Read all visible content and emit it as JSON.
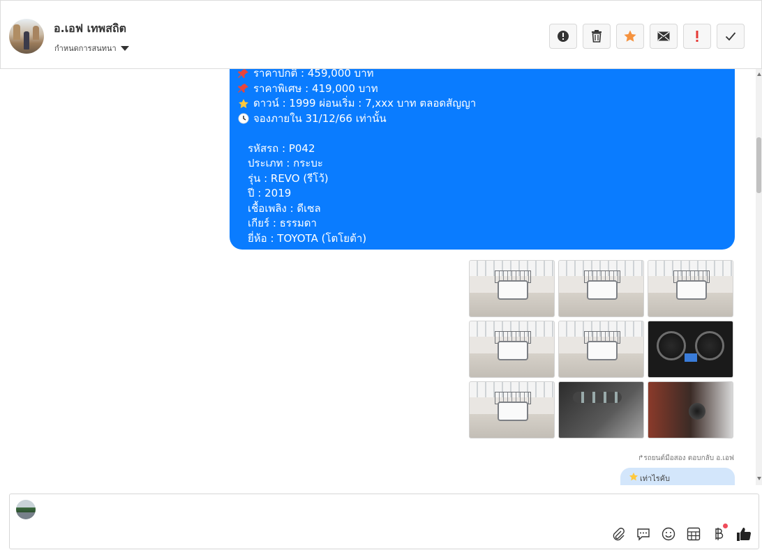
{
  "header": {
    "contact_name": "อ.เอฟ เทพสถิต",
    "assign_label": "กำหนดการสนทนา",
    "actions": [
      {
        "name": "report-button",
        "icon": "alert-circle-icon"
      },
      {
        "name": "delete-button",
        "icon": "trash-icon"
      },
      {
        "name": "star-button",
        "icon": "star-icon"
      },
      {
        "name": "mark-unread-button",
        "icon": "mail-icon"
      },
      {
        "name": "important-button",
        "icon": "exclamation-icon"
      },
      {
        "name": "done-button",
        "icon": "check-icon"
      }
    ]
  },
  "message": {
    "lines": [
      {
        "emoji": "pin-icon",
        "text": "ราคาปกติ : 459,000 บาท"
      },
      {
        "emoji": "pin-icon",
        "text": "ราคาพิเศษ : 419,000 บาท"
      },
      {
        "emoji": "star-icon",
        "text": "ดาวน์ : 1999 ผ่อนเริ่ม : 7,xxx บาท ตลอดสัญญา"
      },
      {
        "emoji": "clock-icon",
        "text": "จองภายใน 31/12/66 เท่านั้น"
      }
    ],
    "specs": [
      "รหัสรถ : P042",
      "ประเภท : กระบะ",
      "รุ่น : REVO (รีโว้)",
      "ปี : 2019",
      "เชื้อเพลิง : ดีเซล",
      "เกียร์ : ธรรมดา",
      "ยี่ห้อ : TOYOTA (โตโยต้า)"
    ],
    "bubble_color": "#0a7cff"
  },
  "photos": {
    "count": 9
  },
  "reply": {
    "note": "รถยนต์มือสอง ตอบกลับ อ.เอฟ",
    "text": "เท่าไรคับ"
  },
  "composer": {
    "tools": [
      "attachment-icon",
      "comment-icon",
      "emoji-icon",
      "calculator-icon",
      "baht-icon",
      "thumbs-up-icon"
    ],
    "accent_color": "#0a7cff"
  }
}
